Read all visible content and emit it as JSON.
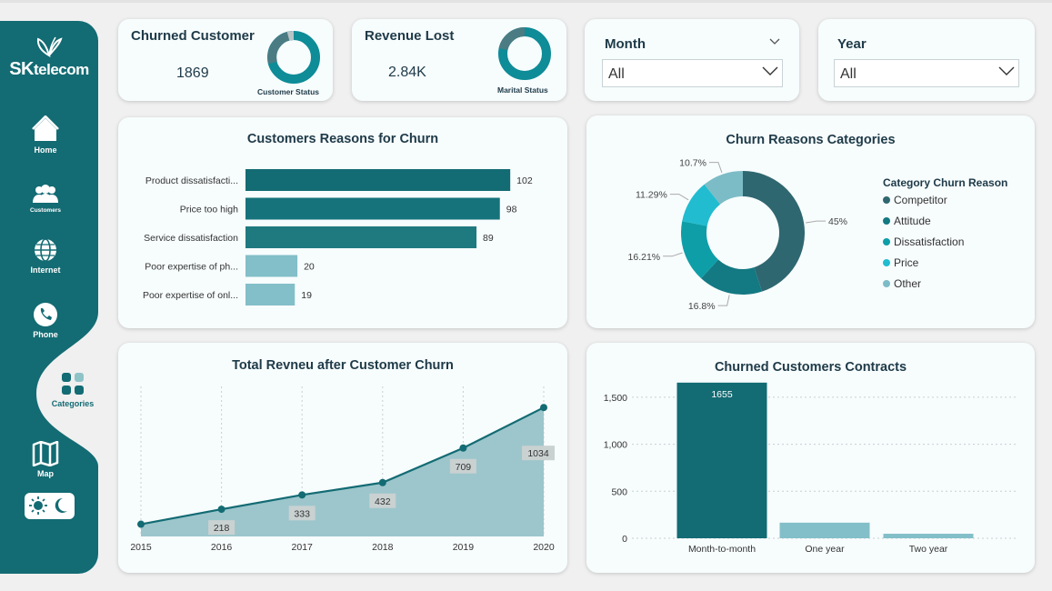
{
  "sidebar": {
    "logo": {
      "sk": "SK",
      "telecom": "telecom"
    },
    "items": [
      {
        "label": "Home"
      },
      {
        "label": "Customers"
      },
      {
        "label": "Internet"
      },
      {
        "label": "Phone"
      },
      {
        "label": "Categories"
      },
      {
        "label": "Map"
      }
    ],
    "active": "Categories"
  },
  "kpis": [
    {
      "title": "Churned Customer",
      "value": "1869",
      "donut_label": "Customer Status"
    },
    {
      "title": "Revenue Lost",
      "value": "2.84K",
      "donut_label": "Marital Status"
    }
  ],
  "slicers": [
    {
      "label": "Month",
      "value": "All"
    },
    {
      "label": "Year",
      "value": "All"
    }
  ],
  "colors": {
    "teal_dark": "#136b73",
    "teal_bar": "#1f7a80",
    "teal_light": "#83bfc8",
    "area_fill": "#9cc6cc",
    "competitor": "#2f6770",
    "attitude": "#137982",
    "dissatisfaction": "#0e9ea8",
    "price": "#21bcd0",
    "other": "#7cbcc6"
  },
  "chart_data": [
    {
      "type": "bar",
      "orientation": "horizontal",
      "title": "Customers Reasons for Churn",
      "categories": [
        "Product dissatisfacti...",
        "Price too high",
        "Service dissatisfaction",
        "Poor expertise of ph...",
        "Poor expertise of onl..."
      ],
      "values": [
        102,
        98,
        89,
        20,
        19
      ],
      "xlim": [
        0,
        110
      ]
    },
    {
      "type": "pie",
      "title": "Churn Reasons Categories",
      "legend_title": "Category Churn Reason",
      "legend_position": "right",
      "categories": [
        "Competitor",
        "Attitude",
        "Dissatisfaction",
        "Price",
        "Other"
      ],
      "values": [
        45,
        16.8,
        16.21,
        11.29,
        10.7
      ],
      "labels": [
        "45%",
        "16.8%",
        "16.21%",
        "11.29%",
        "10.7%"
      ]
    },
    {
      "type": "area",
      "title": "Total Revneu after Customer Churn",
      "x": [
        "2015",
        "2016",
        "2017",
        "2018",
        "2019",
        "2020"
      ],
      "values": [
        98,
        218,
        333,
        432,
        709,
        1034
      ],
      "data_labels": [
        "",
        "218",
        "333",
        "432",
        "709",
        "1034"
      ],
      "ylim": [
        0,
        1050
      ],
      "grid": "vertical dotted"
    },
    {
      "type": "bar",
      "title": "Churned Customers Contracts",
      "categories": [
        "Month-to-month",
        "One year",
        "Two year"
      ],
      "values": [
        1655,
        166,
        48
      ],
      "data_labels": [
        "1655",
        "",
        ""
      ],
      "yticks": [
        "0",
        "500",
        "1,000",
        "1,500"
      ],
      "ylim": [
        0,
        1750
      ],
      "grid": "horizontal dotted"
    }
  ]
}
